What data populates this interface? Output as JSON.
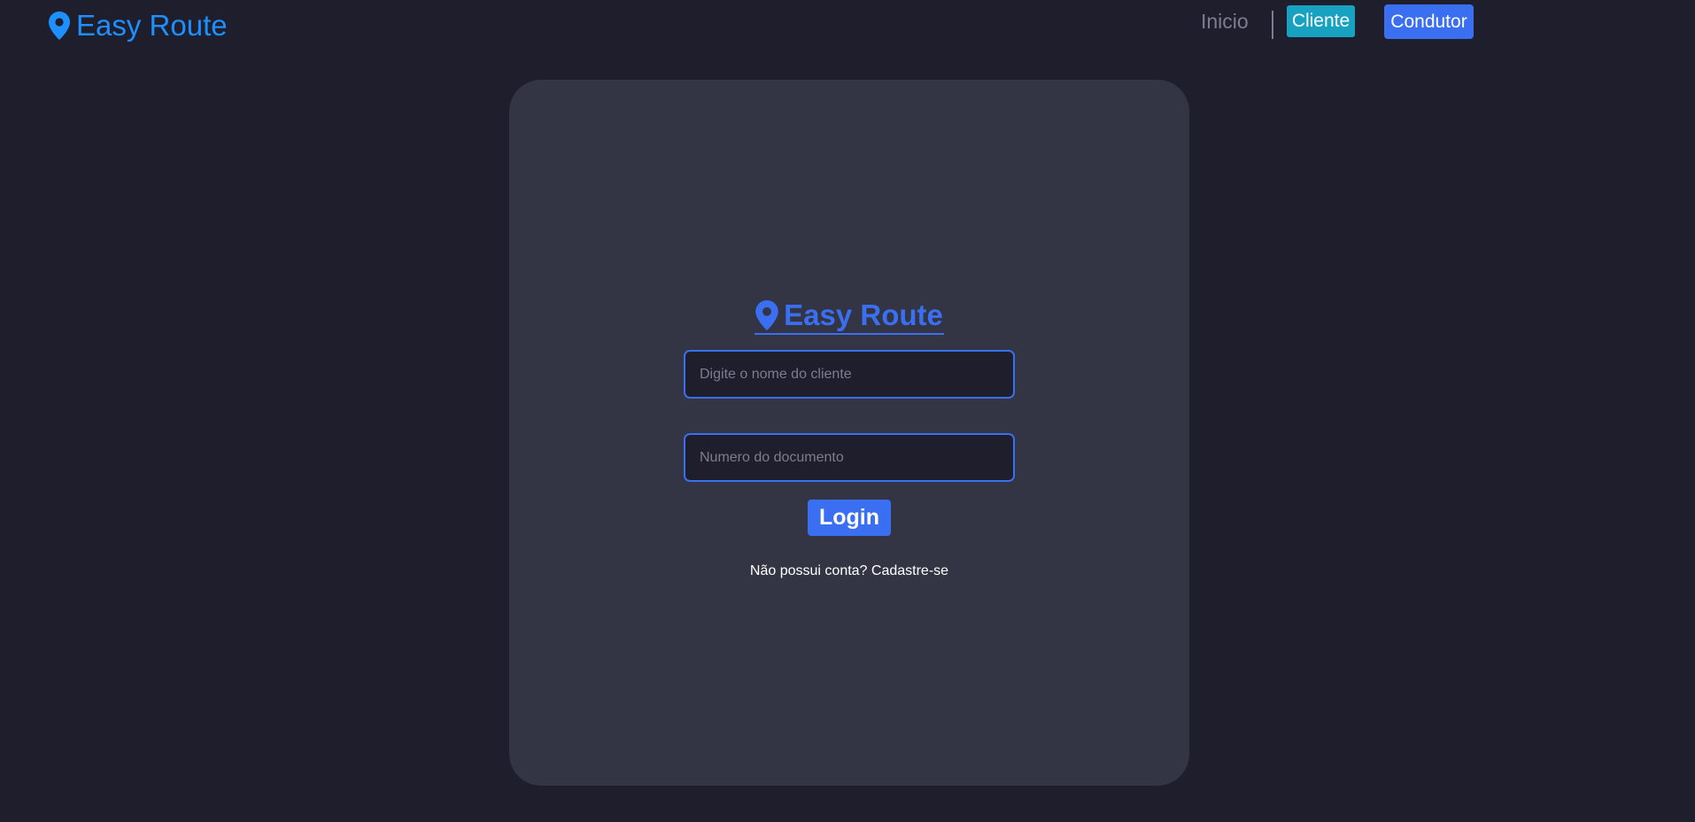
{
  "header": {
    "brand": "Easy Route",
    "brand_icon": "map-marker-icon",
    "brand_color": "#1e8fff",
    "nav": {
      "home": "Inicio",
      "cliente": "Cliente",
      "condutor": "Condutor"
    }
  },
  "login_card": {
    "brand": "Easy Route",
    "brand_icon": "map-marker-icon",
    "name_placeholder": "Digite o nome do cliente",
    "name_value": "",
    "document_placeholder": "Numero do documento",
    "document_value": "",
    "login_label": "Login",
    "signup_prompt": "Não possui conta?",
    "signup_link": "Cadastre-se"
  },
  "colors": {
    "background": "#1e1e2d",
    "card": "#343544",
    "accent": "#3a6ff2",
    "cliente_button": "#17a2c2",
    "muted_text": "#7b7e8c"
  }
}
